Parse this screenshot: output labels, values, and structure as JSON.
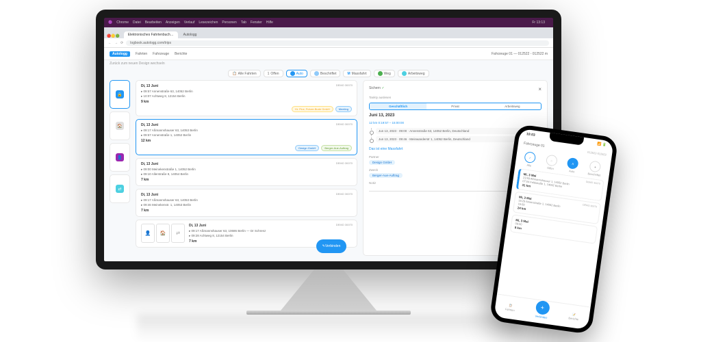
{
  "os": {
    "app": "Chrome",
    "menu": [
      "Datei",
      "Bearbeiten",
      "Anzeigen",
      "Verlauf",
      "Lesezeichen",
      "Personen",
      "Tab",
      "Fenster",
      "Hilfe"
    ],
    "time": "Fr 13:13"
  },
  "browser": {
    "tabs": [
      "Elektronisches Fahrtenbuch…",
      "Autologg"
    ],
    "url": "logbook.autologg.com/trips"
  },
  "header": {
    "logo": "Autologg",
    "nav": [
      "Fahrten",
      "Fahrzeuge",
      "Berichte"
    ],
    "vehicle": "Fahrzeuge 01 — 012522 - 012522 m"
  },
  "subtitle": "Zurück zum neuen Design wechseln",
  "filters": {
    "all": "Alle Fahrten",
    "open": "Offen",
    "auto": "Auto",
    "desc": "Beschriftet",
    "mass": "Massfahrt",
    "way": "Weg",
    "work": "Arbeitsweg"
  },
  "trips": [
    {
      "date": "Di, 13 Juni",
      "badge": "DEMO 30070",
      "s": "09:57  Annenstraße 63, 14052 Berlin",
      "e": "10:07  Achtweg 8, 12154 Berlin",
      "dist": "9 km",
      "tags": [
        "Hr. Flux, Future-Bude GmbH",
        "Meeting"
      ]
    },
    {
      "date": "Di, 13 Juni",
      "badge": "DEMO 30070",
      "s": "09:17  Aßmannshauser 63, 14053 Berlin",
      "e": "09:57  Annenstraße 1, 14052 Berlin",
      "dist": "12 km",
      "tags": [
        "Design GmbH",
        "Berger-Aue-Auftrag"
      ]
    },
    {
      "date": "Di, 13 Juni",
      "badge": "DEMO 30070",
      "s": "09:00  Meinekenstraße 1, 14052 Berlin",
      "e": "09:10  Allerstraße 8, 14054 Berlin",
      "dist": "7 km"
    },
    {
      "date": "Di, 13 Juni",
      "badge": "DEMO 30070",
      "s": "09:17  Aßmannshauser 63, 14053 Berlin",
      "e": "09:46  Meinekenstr. 1, 14053 Berlin",
      "dist": "7 km"
    },
    {
      "date": "Di, 13 Juni",
      "badge": "DEMO 30070",
      "s": "09:17  Aßmannshauser 63, 10686 Berlin — Dr Schrenz",
      "e": "09:28  Achtweg 8, 12154 Berlin",
      "dist": "7 km"
    }
  ],
  "fab": "Verbinden",
  "detail": {
    "save": "Sichern",
    "close": "×",
    "auto": "Tankty auslesen",
    "types": [
      "Geschäftlich",
      "Privat",
      "Arbeitsweg"
    ],
    "title": "Juni 13, 2023",
    "info": "12 km 0:19:57 – 15:00:00",
    "route": [
      {
        "d": "Jun 13, 2023",
        "t": "09:00",
        "a": "Annenstraße 63, 14052 Berlin, Deutschland"
      },
      {
        "d": "Jun 13, 2023",
        "t": "09:46",
        "a": "Meinwanderstr 1, 14052 Berlin, Deutschland"
      }
    ],
    "mass": "Das ist eine Massfahrt",
    "partner_lbl": "Partner",
    "partner": "Design GmbH",
    "zweck_lbl": "Zweck",
    "zweck": "Berger-Aue-Auftrag",
    "notiz_lbl": "Notiz"
  },
  "phone": {
    "time": "10:03",
    "vehicle": "Fahrzeuge 01",
    "range": "012522-012522",
    "filters": [
      "Alle",
      "Offen",
      "Auto",
      "Beschriftet"
    ],
    "trips": [
      {
        "date": "Mi, 3 Mai",
        "badge": "DEMO 30070",
        "s": "23:59  Aßmannshauser 1, 14052 Berlin",
        "e": "07:04  Feldstraße 1, 14052 Berlin",
        "dist": "31 km"
      },
      {
        "date": "Mi, 3 Mai",
        "badge": "DEMO 30070",
        "s": "15:29  Annenstraße 1, 14052 Berlin",
        "e": "15:59",
        "dist": "24 km"
      },
      {
        "date": "Mi, 3 Mai",
        "s": "08:00",
        "dist": "8 km"
      }
    ],
    "nav": [
      "Fahrten",
      "Verbinden",
      "Berichte"
    ]
  }
}
